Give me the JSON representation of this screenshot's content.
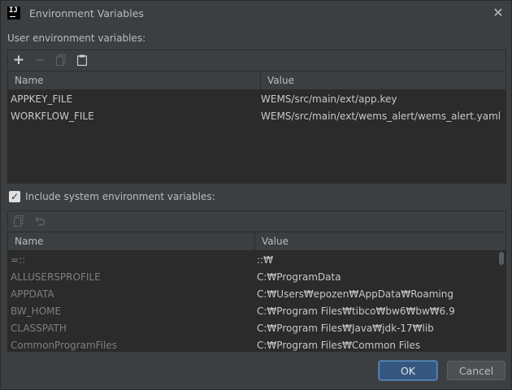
{
  "window": {
    "title": "Environment Variables"
  },
  "user_section": {
    "label": "User environment variables:",
    "columns": [
      "Name",
      "Value"
    ],
    "rows": [
      {
        "name": "APPKEY_FILE",
        "value": "WEMS/src/main/ext/app.key"
      },
      {
        "name": "WORKFLOW_FILE",
        "value": "WEMS/src/main/ext/wems_alert/wems_alert.yaml"
      }
    ]
  },
  "system_section": {
    "checkbox_label": "Include system environment variables:",
    "checked": true,
    "columns": [
      "Name",
      "Value"
    ],
    "rows": [
      {
        "name": "=::",
        "value": "::₩"
      },
      {
        "name": "ALLUSERSPROFILE",
        "value": "C:₩ProgramData"
      },
      {
        "name": "APPDATA",
        "value": "C:₩Users₩epozen₩AppData₩Roaming"
      },
      {
        "name": "BW_HOME",
        "value": "C:₩Program Files₩tibco₩bw6₩bw₩6.9"
      },
      {
        "name": "CLASSPATH",
        "value": "C:₩Program Files₩Java₩jdk-17₩lib"
      },
      {
        "name": "CommonProgramFiles",
        "value": "C:₩Program Files₩Common Files"
      }
    ]
  },
  "buttons": {
    "ok": "OK",
    "cancel": "Cancel"
  },
  "icons": {
    "app": "IJ",
    "add": "+",
    "remove": "−",
    "close": "✕",
    "checkmark": "✓"
  },
  "colors": {
    "background": "#3c3f41",
    "table_background": "#2b2b2b",
    "primary_button": "#365880",
    "primary_button_border": "#5e8cc2"
  }
}
